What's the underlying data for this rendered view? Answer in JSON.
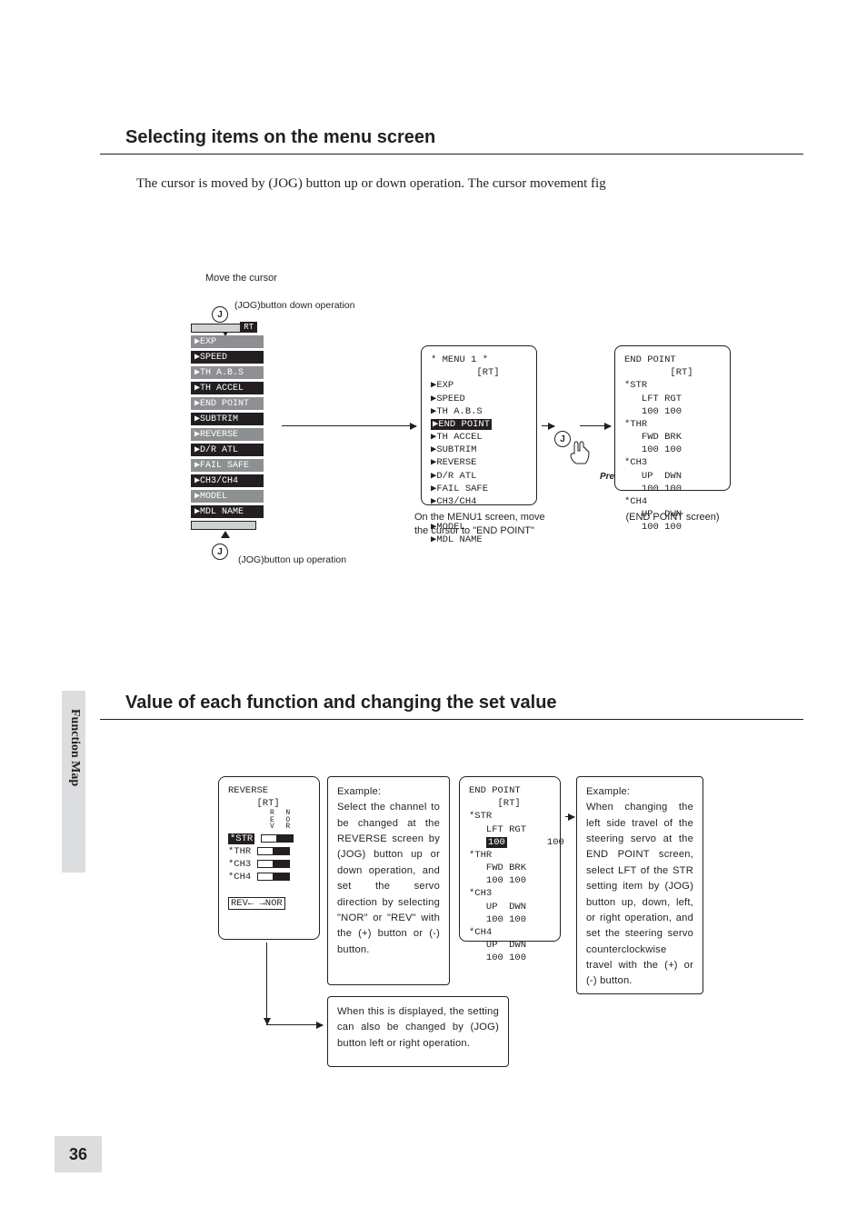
{
  "section1": {
    "heading": "Selecting items on the menu screen",
    "body": "The cursor is moved by (JOG) button up or down operation. The cursor movement fig"
  },
  "fig1": {
    "moveCursor": "Move the cursor",
    "jogDown": "(JOG)button down operation",
    "jogUp": "(JOG)button up operation",
    "pressLabel": "Press",
    "jogGlyph": "J",
    "ribbonBadge": "RT",
    "ribbonItems": [
      "EXP",
      "SPEED",
      "TH A.B.S",
      "TH ACCEL",
      "END POINT",
      "SUBTRIM",
      "REVERSE",
      "D/R ATL",
      "FAIL SAFE",
      "CH3/CH4",
      "MODEL",
      "MDL NAME"
    ],
    "lcd1": "* MENU 1 *\n        [RT]\n▶EXP\n▶SPEED\n▶TH A.B.S\n▶TH ACCEL\n▶SUBTRIM\n▶REVERSE\n▶D/R ATL\n▶FAIL SAFE\n▶CH3/CH4\n\n▶MODEL\n▶MDL NAME",
    "lcd1h": "END POINT",
    "lcd2": "END POINT\n        [RT]\n*STR\n   LFT RGT\n   100 100\n*THR\n   FWD BRK\n   100 100\n*CH3\n   UP  DWN\n   100 100\n*CH4\n   UP  DWN\n   100 100",
    "caption1": "On the MENU1 screen, move the cursor to \"END POINT\"",
    "caption2": "(END POINT screen)"
  },
  "section2": {
    "heading": "Value of each function and changing the set value"
  },
  "fig2": {
    "lcdA_header": "REVERSE\n     [RT]",
    "lcdA_rows": [
      {
        "name": "*STR",
        "sel": true
      },
      {
        "name": "*THR",
        "sel": false
      },
      {
        "name": "*CH3",
        "sel": false
      },
      {
        "name": "*CH4",
        "sel": false
      }
    ],
    "lcdA_footer": "REV← →NOR",
    "lcdA_axis": "R\nE\nV",
    "lcdA_axis2": "N\nO\nR",
    "boxA_title": "Example:",
    "boxA_body": "Select the channel to be changed at the REVERSE screen by (JOG) button up or down operation, and set the servo direction by selecting \"NOR\" or \"REV\" with the (+) button or (-) button.",
    "lcdB": "END POINT\n     [RT]\n*STR\n   LFT RGT\n       100\n*THR\n   FWD BRK\n   100 100\n*CH3\n   UP  DWN\n   100 100\n*CH4\n   UP  DWN\n   100 100",
    "lcdB_hl": "100",
    "boxB_title": "Example:",
    "boxB_body": "When changing the left side travel of the steering servo at the END POINT screen, select LFT of the STR setting item by (JOG) button up, down, left, or right operation, and set the steering servo counterclockwise travel with the (+) or (-) button.",
    "boxC_body": "When this is displayed, the setting can also be changed by (JOG) button left or right operation."
  },
  "sideTab": "Function Map",
  "pageNum": "36"
}
